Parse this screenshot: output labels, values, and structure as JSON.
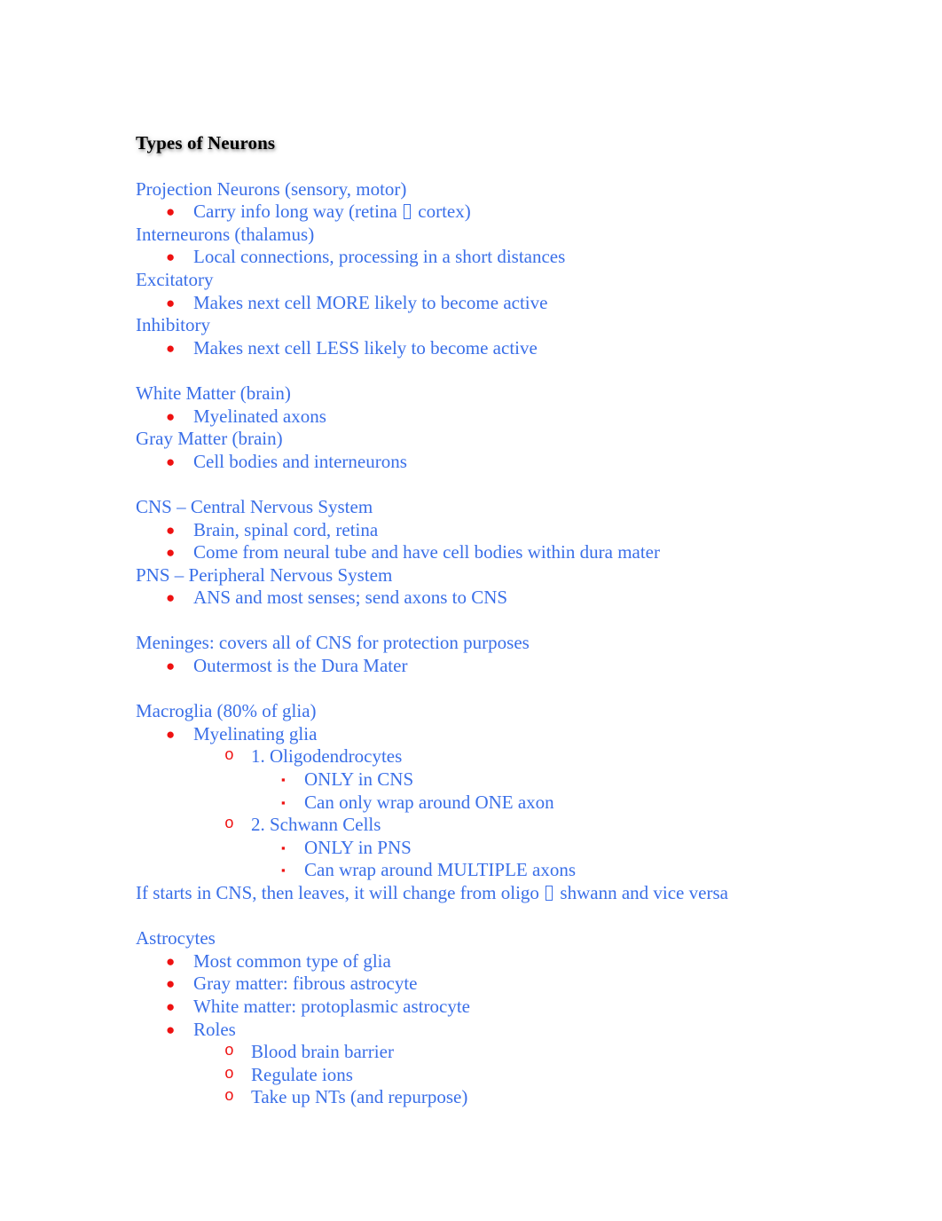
{
  "document": {
    "title": "Types of Neurons",
    "colors": {
      "body_text": "#3A6FE8",
      "bullet": "#EE1111",
      "title_text": "#000000",
      "page_background": "#FFFFFF"
    },
    "blocks": [
      {
        "id": "projection-interneurons-excitatory-inhibitory",
        "lines": [
          {
            "level": 0,
            "text": "Projection Neurons (sensory, motor)"
          },
          {
            "level": 1,
            "marker": "disc",
            "text_before": "Carry info long way (retina ",
            "tofu": true,
            "text_after": " cortex)"
          },
          {
            "level": 0,
            "text": "Interneurons (thalamus)"
          },
          {
            "level": 1,
            "marker": "disc",
            "text": "Local connections, processing in a short distances"
          },
          {
            "level": 0,
            "text": "Excitatory"
          },
          {
            "level": 1,
            "marker": "disc",
            "text": "Makes next cell MORE likely to become active"
          },
          {
            "level": 0,
            "text": "Inhibitory"
          },
          {
            "level": 1,
            "marker": "disc",
            "text": "Makes next cell LESS likely to become active"
          }
        ]
      },
      {
        "id": "white-gray-matter",
        "lines": [
          {
            "level": 0,
            "text": "White Matter (brain)"
          },
          {
            "level": 1,
            "marker": "disc",
            "text": "Myelinated axons"
          },
          {
            "level": 0,
            "text": "Gray Matter (brain)"
          },
          {
            "level": 1,
            "marker": "disc",
            "text": "Cell bodies and interneurons"
          }
        ]
      },
      {
        "id": "cns-pns",
        "lines": [
          {
            "level": 0,
            "text": "CNS – Central Nervous System"
          },
          {
            "level": 1,
            "marker": "disc",
            "text": "Brain, spinal cord, retina"
          },
          {
            "level": 1,
            "marker": "disc",
            "text": "Come from neural tube and have cell bodies within dura mater"
          },
          {
            "level": 0,
            "text": "PNS – Peripheral Nervous System"
          },
          {
            "level": 1,
            "marker": "disc",
            "text": "ANS and most senses; send axons to CNS"
          }
        ]
      },
      {
        "id": "meninges",
        "lines": [
          {
            "level": 0,
            "text": "Meninges: covers all of CNS for protection purposes"
          },
          {
            "level": 1,
            "marker": "disc",
            "text": "Outermost is the Dura Mater"
          }
        ]
      },
      {
        "id": "macroglia",
        "lines": [
          {
            "level": 0,
            "text": "Macroglia (80% of glia)"
          },
          {
            "level": 1,
            "marker": "disc",
            "text": "Myelinating glia"
          },
          {
            "level": 2,
            "marker": "o",
            "text": "1. Oligodendrocytes"
          },
          {
            "level": 3,
            "marker": "square",
            "text": "ONLY in CNS"
          },
          {
            "level": 3,
            "marker": "square",
            "text": "Can only wrap around ONE axon"
          },
          {
            "level": 2,
            "marker": "o",
            "text": "2. Schwann Cells"
          },
          {
            "level": 3,
            "marker": "square",
            "text": "ONLY in PNS"
          },
          {
            "level": 3,
            "marker": "square",
            "text": "Can wrap around MULTIPLE axons"
          },
          {
            "level": 0,
            "text_before": "If starts in CNS, then leaves, it will change from oligo ",
            "tofu": true,
            "text_after": " shwann and vice versa"
          }
        ]
      },
      {
        "id": "astrocytes",
        "lines": [
          {
            "level": 0,
            "text": "Astrocytes"
          },
          {
            "level": 1,
            "marker": "disc",
            "text": "Most common type of glia"
          },
          {
            "level": 1,
            "marker": "disc",
            "text": "Gray matter: fibrous astrocyte"
          },
          {
            "level": 1,
            "marker": "disc",
            "text": "White matter: protoplasmic astrocyte"
          },
          {
            "level": 1,
            "marker": "disc",
            "text": "Roles"
          },
          {
            "level": 2,
            "marker": "o",
            "text": "Blood brain barrier"
          },
          {
            "level": 2,
            "marker": "o",
            "text": "Regulate ions"
          },
          {
            "level": 2,
            "marker": "o",
            "text": "Take up NTs (and repurpose)"
          }
        ]
      }
    ],
    "markers": {
      "disc": "●",
      "o": "o",
      "square": "▪"
    }
  }
}
